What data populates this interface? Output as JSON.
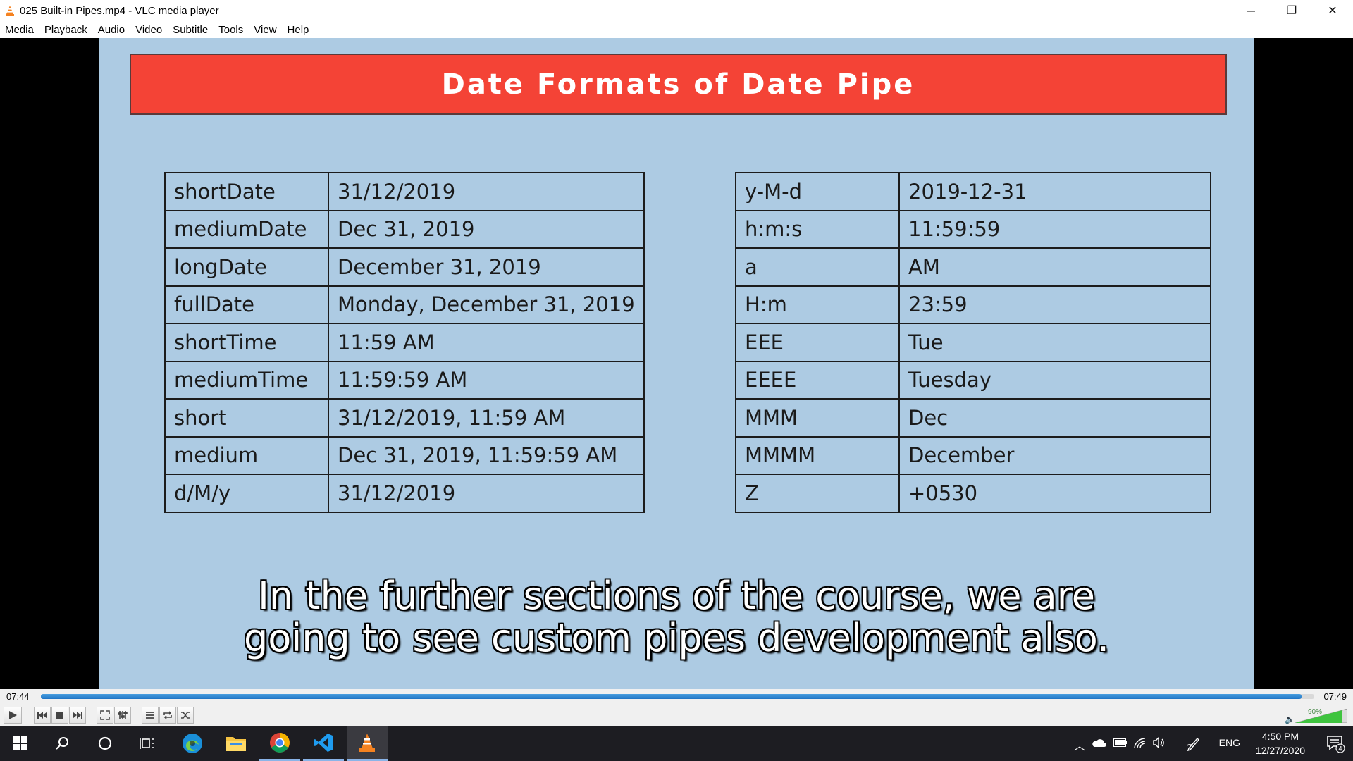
{
  "window": {
    "title": "025 Built-in Pipes.mp4 - VLC media player",
    "minimize_glyph": "—",
    "restore_glyph": "❐",
    "close_glyph": "✕"
  },
  "menu": [
    "Media",
    "Playback",
    "Audio",
    "Video",
    "Subtitle",
    "Tools",
    "View",
    "Help"
  ],
  "slide": {
    "title": "Date Formats of Date Pipe",
    "left_table": [
      [
        "shortDate",
        "31/12/2019"
      ],
      [
        "mediumDate",
        "Dec 31, 2019"
      ],
      [
        "longDate",
        "December 31, 2019"
      ],
      [
        "fullDate",
        "Monday, December 31, 2019"
      ],
      [
        "shortTime",
        "11:59 AM"
      ],
      [
        "mediumTime",
        "11:59:59 AM"
      ],
      [
        "short",
        "31/12/2019, 11:59 AM"
      ],
      [
        "medium",
        "Dec 31, 2019, 11:59:59 AM"
      ],
      [
        "d/M/y",
        "31/12/2019"
      ]
    ],
    "right_table": [
      [
        "y-M-d",
        "2019-12-31"
      ],
      [
        "h:m:s",
        "11:59:59"
      ],
      [
        "a",
        "AM"
      ],
      [
        "H:m",
        "23:59"
      ],
      [
        "EEE",
        "Tue"
      ],
      [
        "EEEE",
        "Tuesday"
      ],
      [
        "MMM",
        "Dec"
      ],
      [
        "MMMM",
        "December"
      ],
      [
        "Z",
        "+0530"
      ]
    ]
  },
  "subtitle": {
    "line1": "In the further sections of the course, we are",
    "line2": "going to see custom pipes development also."
  },
  "player": {
    "elapsed": "07:44",
    "total": "07:49",
    "progress_fraction": 0.99,
    "volume_label": "90%",
    "volume_fraction": 0.9
  },
  "taskbar": {
    "apps": [
      "start-icon",
      "search-icon",
      "cortana-icon",
      "task-view-icon",
      "edge-icon",
      "file-explorer-icon",
      "chrome-icon",
      "vscode-icon",
      "vlc-icon"
    ],
    "language": "ENG",
    "time": "4:50 PM",
    "date": "12/27/2020",
    "notification_count": "4"
  },
  "colors": {
    "slide_bg": "#adcbe3",
    "banner": "#f44336",
    "seek_fill": "#1f74c5",
    "taskbar": "#1d1d22"
  }
}
